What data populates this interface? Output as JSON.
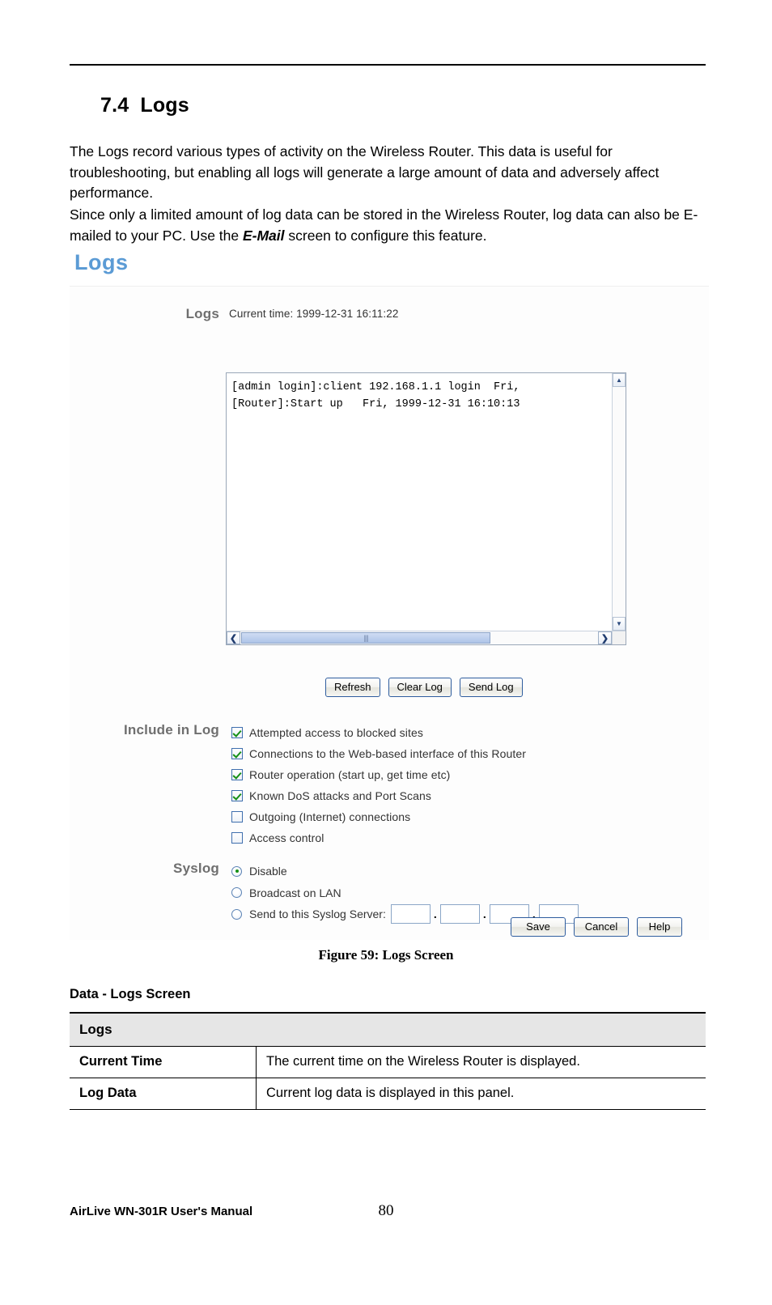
{
  "document": {
    "section_number": "7.4",
    "section_title": "Logs",
    "paragraph_1": "The Logs record various types of activity on the Wireless Router. This data is useful for troubleshooting, but enabling all logs will generate a large amount of data and adversely affect performance.",
    "paragraph_2_part1": "Since only a limited amount of log data can be stored in the Wireless Router, log data can also be E-mailed to your PC. Use the ",
    "paragraph_2_emphasis": "E-Mail",
    "paragraph_2_part2": " screen to configure this feature.",
    "figure_caption": "Figure 59: Logs Screen",
    "data_title": "Data - Logs Screen",
    "footer_manual": "AirLive WN-301R User's Manual",
    "footer_page": "80"
  },
  "screenshot": {
    "title": "Logs",
    "accent_color": "#5b9bd5",
    "logs_section": {
      "label": "Logs",
      "current_time_text": "Current time: 1999-12-31 16:11:22",
      "log_lines": "[admin login]:client 192.168.1.1 login  Fri,\n[Router]:Start up   Fri, 1999-12-31 16:10:13",
      "scroll_up_glyph": "▲",
      "scroll_down_glyph": "▼",
      "scroll_left_glyph": "❮",
      "scroll_right_glyph": "❯",
      "thumb_grip": "||||"
    },
    "log_buttons": [
      {
        "label": "Refresh"
      },
      {
        "label": "Clear Log"
      },
      {
        "label": "Send Log"
      }
    ],
    "include_in_log": {
      "label": "Include in Log",
      "items": [
        {
          "label": "Attempted access to blocked sites",
          "checked": true
        },
        {
          "label": "Connections to the Web-based interface of this Router",
          "checked": true
        },
        {
          "label": "Router operation (start up, get time etc)",
          "checked": true
        },
        {
          "label": "Known DoS attacks and Port Scans",
          "checked": true
        },
        {
          "label": "Outgoing (Internet) connections",
          "checked": false
        },
        {
          "label": "Access control",
          "checked": false
        }
      ]
    },
    "syslog": {
      "label": "Syslog",
      "options": [
        {
          "label": "Disable",
          "selected": true
        },
        {
          "label": "Broadcast on LAN",
          "selected": false
        },
        {
          "label": "Send to this Syslog Server:",
          "selected": false
        }
      ],
      "server_ip_octets": [
        "",
        "",
        "",
        ""
      ],
      "octet_separator": "."
    },
    "form_buttons": [
      {
        "label": "Save"
      },
      {
        "label": "Cancel"
      },
      {
        "label": "Help"
      }
    ]
  },
  "data_table": {
    "section_header": "Logs",
    "rows": [
      {
        "key": "Current Time",
        "value": "The current time on the Wireless Router is displayed."
      },
      {
        "key": "Log Data",
        "value": "Current log data is displayed in this panel."
      }
    ]
  }
}
